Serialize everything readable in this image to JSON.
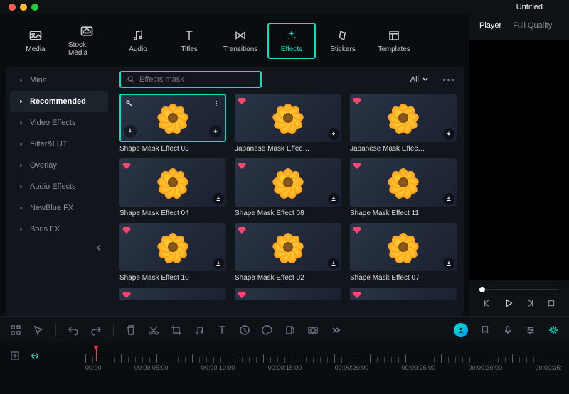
{
  "title": "Untitled",
  "topTabs": [
    {
      "label": "Media"
    },
    {
      "label": "Stock Media"
    },
    {
      "label": "Audio"
    },
    {
      "label": "Titles"
    },
    {
      "label": "Transitions"
    },
    {
      "label": "Effects"
    },
    {
      "label": "Stickers"
    },
    {
      "label": "Templates"
    }
  ],
  "activeTopTab": 5,
  "sidebar": [
    {
      "label": "Mine"
    },
    {
      "label": "Recommended"
    },
    {
      "label": "Video Effects"
    },
    {
      "label": "Filter&LUT"
    },
    {
      "label": "Overlay"
    },
    {
      "label": "Audio Effects"
    },
    {
      "label": "NewBlue FX"
    },
    {
      "label": "Boris FX"
    }
  ],
  "activeSidebar": 1,
  "search": {
    "placeholder": "Effects mask"
  },
  "filter": {
    "label": "All"
  },
  "effects": [
    {
      "label": "Shape Mask Effect 03",
      "selected": true
    },
    {
      "label": "Japanese Mask Effec…"
    },
    {
      "label": "Japanese Mask Effec…"
    },
    {
      "label": "Shape Mask Effect 04"
    },
    {
      "label": "Shape Mask Effect 08"
    },
    {
      "label": "Shape Mask Effect 11"
    },
    {
      "label": "Shape Mask Effect 10"
    },
    {
      "label": "Shape Mask Effect 02"
    },
    {
      "label": "Shape Mask Effect 07"
    }
  ],
  "playerTabs": {
    "player": "Player",
    "fullQuality": "Full Quality"
  },
  "timeline": {
    "labels": [
      "00:00",
      "00:00:05:00",
      "00:00:10:00",
      "00:00:15:00",
      "00:00:20:00",
      "00:00:25:00",
      "00:00:30:00",
      "00:00:35:"
    ]
  }
}
